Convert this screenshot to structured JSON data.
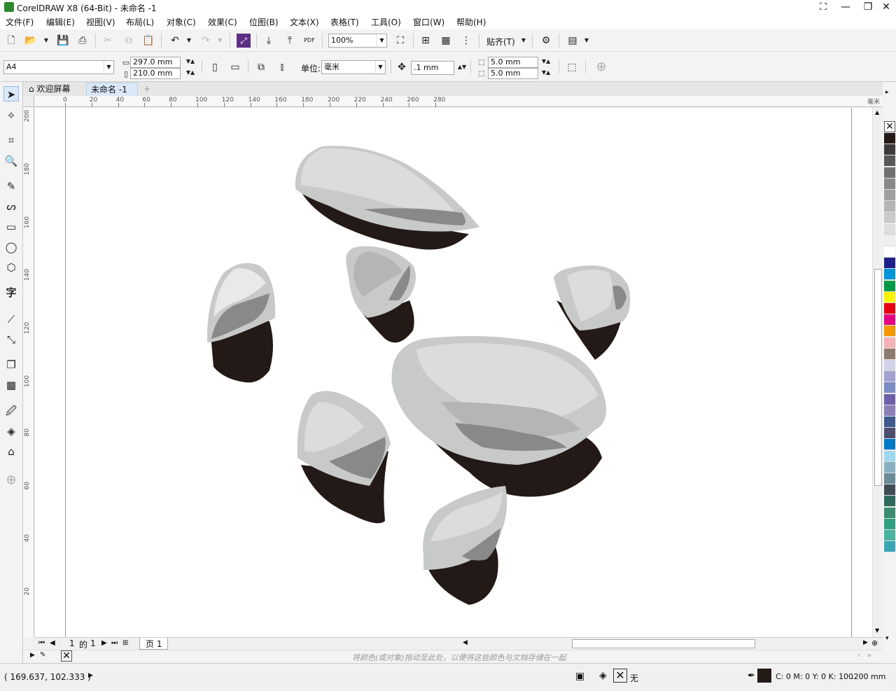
{
  "window": {
    "title": "CorelDRAW X8 (64-Bit) - 未命名 -1"
  },
  "menu": [
    "文件(F)",
    "编辑(E)",
    "视图(V)",
    "布局(L)",
    "对象(C)",
    "效果(C)",
    "位图(B)",
    "文本(X)",
    "表格(T)",
    "工具(O)",
    "窗口(W)",
    "帮助(H)"
  ],
  "toolbar": {
    "zoom": "100%",
    "snap_label": "贴齐(T)",
    "pdf_label": "PDF"
  },
  "property_bar": {
    "page_size": "A4",
    "width": "297.0 mm",
    "height": "210.0 mm",
    "unit_label": "单位:",
    "unit": "毫米",
    "nudge": ".1 mm",
    "dup_x": "5.0 mm",
    "dup_y": "5.0 mm"
  },
  "tabs": {
    "welcome": "欢迎屏幕",
    "document": "未命名 -1"
  },
  "ruler": {
    "h_ticks": [
      "0",
      "20",
      "40",
      "60",
      "80",
      "100",
      "120",
      "140",
      "160",
      "180",
      "200",
      "220",
      "240",
      "260",
      "280"
    ],
    "v_ticks": [
      "200",
      "180",
      "160",
      "140",
      "120",
      "100",
      "80",
      "60",
      "40",
      "20"
    ],
    "unit": "毫米"
  },
  "pagebar": {
    "current": "1",
    "of_label": "的",
    "total": "1",
    "page_tab": "页 1"
  },
  "docpalette_hint": "将颜色(或对象)拖动至此处，以便将这些颜色与文档存储在一起",
  "status": {
    "coords": "( 169.637, 102.333 )",
    "fill_label": "无",
    "color_info": "C: 0 M: 0 Y: 0 K: 100",
    "outline_width": ".200 mm"
  },
  "palette_colors": [
    "#231916",
    "#3e3a39",
    "#595757",
    "#727171",
    "#898989",
    "#9fa0a0",
    "#b5b5b6",
    "#c9caca",
    "#dcdddd",
    "#efefef",
    "#ffffff",
    "#1d2088",
    "#0095d9",
    "#009944",
    "#fff100",
    "#e60012",
    "#e4007f",
    "#f39800",
    "#f5b2b2",
    "#8f7a6e",
    "#d1d1e8",
    "#a3a3d1",
    "#7b8cc4",
    "#6f5fa8",
    "#8c7fb8",
    "#3e5a8f",
    "#4d4d70",
    "#0078c8",
    "#a0d8ef",
    "#88b0c0",
    "#6b8a9a",
    "#3f4c56",
    "#2e6b5c",
    "#3d8b6f",
    "#2fa07f",
    "#4bb3a0",
    "#3aa5b4"
  ]
}
